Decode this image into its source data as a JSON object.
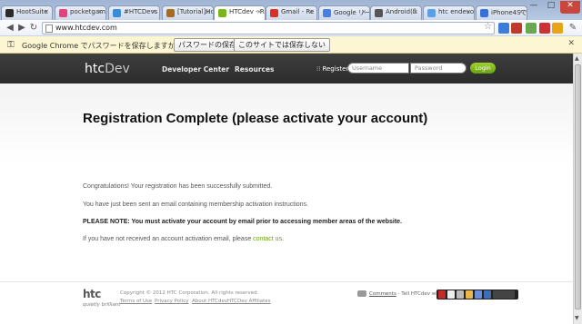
{
  "browser": {
    "tabs": [
      {
        "label": "HootSuite",
        "color": "#2b2b2b"
      },
      {
        "label": "pocketgam",
        "color": "#e8407a"
      },
      {
        "label": "#HTCDevs",
        "color": "#3a8cd8"
      },
      {
        "label": "[Tutorial]Ho",
        "color": "#a66b1e"
      },
      {
        "label": "HTCdev - R",
        "color": "#7ab51d"
      },
      {
        "label": "Gmail - Re",
        "color": "#d93025"
      },
      {
        "label": "Google リー",
        "color": "#4a7fe0"
      },
      {
        "label": "Android(ß",
        "color": "#555555"
      },
      {
        "label": "htc endevo",
        "color": "#5aa0e8"
      },
      {
        "label": "iPhone4Sで",
        "color": "#3b6fd8"
      }
    ],
    "url": "www.htcdev.com",
    "window_controls": {
      "minimize": "—",
      "maximize": "□",
      "close": "✕"
    }
  },
  "infobar": {
    "message": "Google Chrome でパスワードを保存しますか？",
    "save_button": "パスワードの保存",
    "never_button": "このサイトでは保存しない",
    "close": "✕"
  },
  "header": {
    "logo_htc": "htc",
    "logo_dev": "Dev",
    "nav": [
      "Developer Center",
      "Resources"
    ],
    "register": "Register",
    "username_placeholder": "Username",
    "password_placeholder": "Password",
    "login": "Login"
  },
  "main": {
    "title": "Registration Complete (please activate your account)",
    "line1": "Congratulations! Your registration has been successfully submitted.",
    "line2": "You have just been sent an email containing membership activation instructions.",
    "note": "PLEASE NOTE: You must activate your account by email prior to accessing member areas of the website.",
    "line4_prefix": "If you have not received an account activation email, please ",
    "line4_link": "contact us",
    "line4_suffix": "."
  },
  "footer": {
    "logo": "htc",
    "tagline": "quietly brilliant",
    "copyright": "Copyright © 2012 HTC Corporation. All rights reserved.",
    "links": [
      "Terms of Use",
      "Privacy Policy",
      "About HTCdev",
      "HTCDev Affiliates"
    ],
    "comments_link": "Comments",
    "comments_text": " - Tell HTCdev what"
  },
  "colors": {
    "accent_green": "#7ab51d",
    "header_bg": "#333333"
  }
}
